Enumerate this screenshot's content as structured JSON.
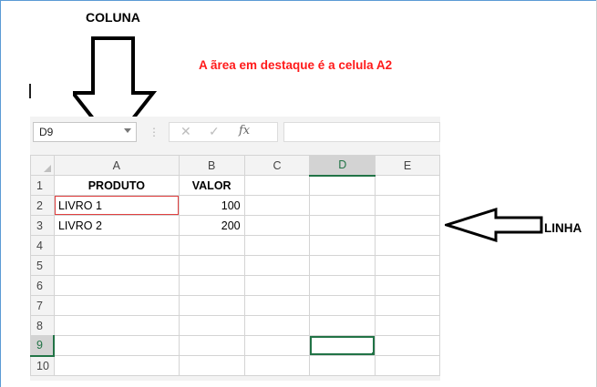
{
  "annotations": {
    "column_label": "COLUNA",
    "row_label": "LINHA",
    "caption": "A ãrea em destaque é a celula A2"
  },
  "formula_bar": {
    "name_box": "D9",
    "cancel_icon": "✕",
    "enter_icon": "✓",
    "function_icon": "fx",
    "formula_value": ""
  },
  "columns": [
    "A",
    "B",
    "C",
    "D",
    "E"
  ],
  "rows": [
    {
      "num": "1",
      "A": "PRODUTO",
      "B": "VALOR",
      "C": "",
      "D": "",
      "E": ""
    },
    {
      "num": "2",
      "A": "LIVRO 1",
      "B": "100",
      "C": "",
      "D": "",
      "E": ""
    },
    {
      "num": "3",
      "A": "LIVRO 2",
      "B": "200",
      "C": "",
      "D": "",
      "E": ""
    },
    {
      "num": "4",
      "A": "",
      "B": "",
      "C": "",
      "D": "",
      "E": ""
    },
    {
      "num": "5",
      "A": "",
      "B": "",
      "C": "",
      "D": "",
      "E": ""
    },
    {
      "num": "6",
      "A": "",
      "B": "",
      "C": "",
      "D": "",
      "E": ""
    },
    {
      "num": "7",
      "A": "",
      "B": "",
      "C": "",
      "D": "",
      "E": ""
    },
    {
      "num": "8",
      "A": "",
      "B": "",
      "C": "",
      "D": "",
      "E": ""
    },
    {
      "num": "9",
      "A": "",
      "B": "",
      "C": "",
      "D": "",
      "E": ""
    },
    {
      "num": "10",
      "A": "",
      "B": "",
      "C": "",
      "D": "",
      "E": ""
    }
  ],
  "selection": {
    "active_cell": "D9",
    "highlighted_cell": "A2"
  },
  "colors": {
    "accent": "#217346",
    "highlight": "#e04040",
    "caption": "#ff1a1a"
  }
}
